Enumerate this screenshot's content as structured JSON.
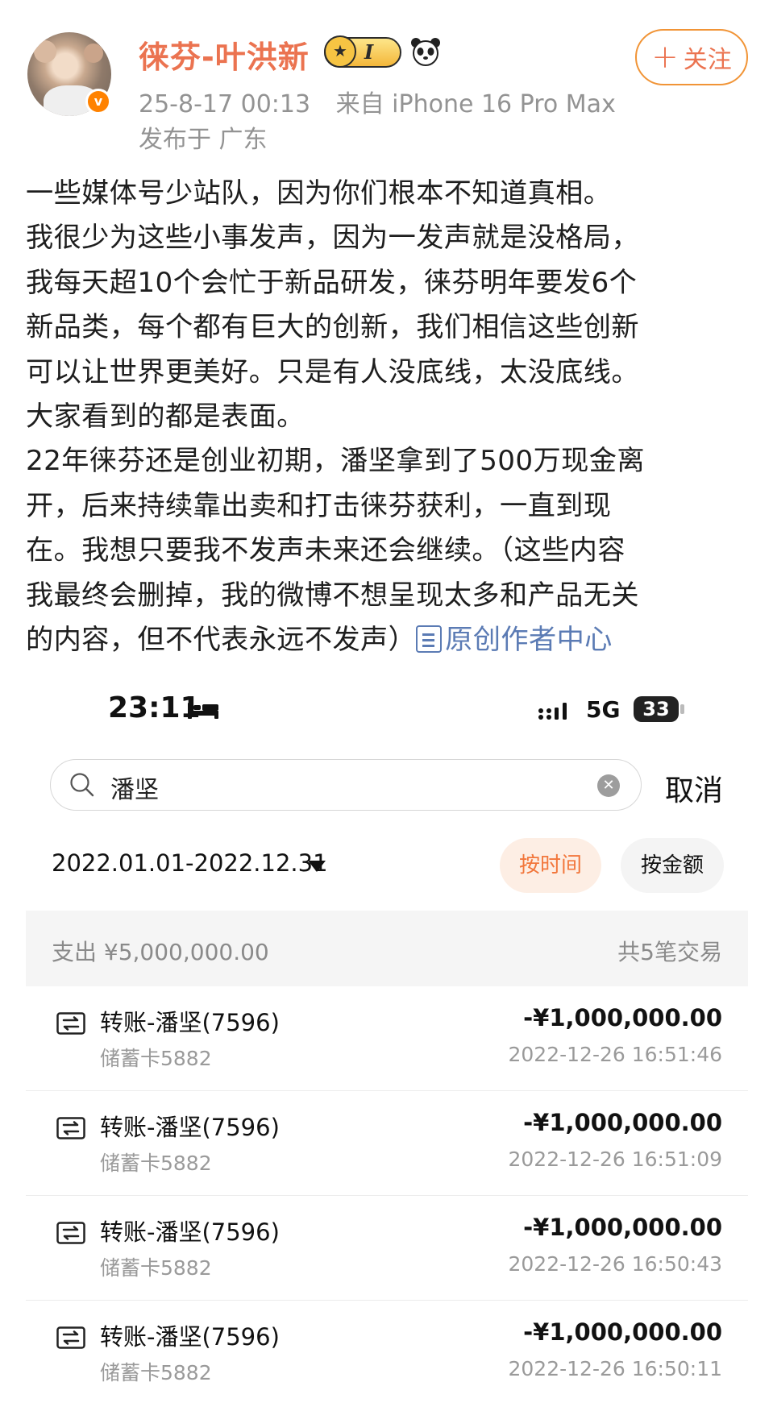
{
  "post": {
    "username": "徕芬-叶洪新",
    "vip_level": "I",
    "follow_label": "关注",
    "timestamp": "25-8-17 00:13",
    "source": "来自 iPhone 16 Pro Max",
    "location": "发布于 广东",
    "lines": [
      "一些媒体号少站队，因为你们根本不知道真相。",
      "我很少为这些小事发声，因为一发声就是没格局，",
      "我每天超10个会忙于新品研发，徕芬明年要发6个",
      "新品类，每个都有巨大的创新，我们相信这些创新",
      "可以让世界更美好。只是有人没底线，太没底线。",
      "大家看到的都是表面。",
      "22年徕芬还是创业初期，潘坚拿到了500万现金离",
      "开，后来持续靠出卖和打击徕芬获利，一直到现",
      "在。我想只要我不发声未来还会继续。（这些内容",
      "我最终会删掉，我的微博不想呈现太多和产品无关",
      "的内容，但不代表永远不发声）"
    ],
    "link_text": "原创作者中心"
  },
  "phone": {
    "status": {
      "time": "23:11",
      "network": "5G",
      "battery": "33"
    },
    "search": {
      "query": "潘坚",
      "cancel_label": "取消"
    },
    "filter": {
      "date_range": "2022.01.01-2022.12.31",
      "sort_by_time": "按时间",
      "sort_by_amount": "按金额"
    },
    "summary": {
      "expense": "支出 ¥5,000,000.00",
      "count": "共5笔交易"
    },
    "transactions": [
      {
        "title": "转账-潘坚(7596)",
        "card": "储蓄卡5882",
        "amount": "-¥1,000,000.00",
        "time": "2022-12-26 16:51:46"
      },
      {
        "title": "转账-潘坚(7596)",
        "card": "储蓄卡5882",
        "amount": "-¥1,000,000.00",
        "time": "2022-12-26 16:51:09"
      },
      {
        "title": "转账-潘坚(7596)",
        "card": "储蓄卡5882",
        "amount": "-¥1,000,000.00",
        "time": "2022-12-26 16:50:43"
      },
      {
        "title": "转账-潘坚(7596)",
        "card": "储蓄卡5882",
        "amount": "-¥1,000,000.00",
        "time": "2022-12-26 16:50:11"
      }
    ]
  }
}
